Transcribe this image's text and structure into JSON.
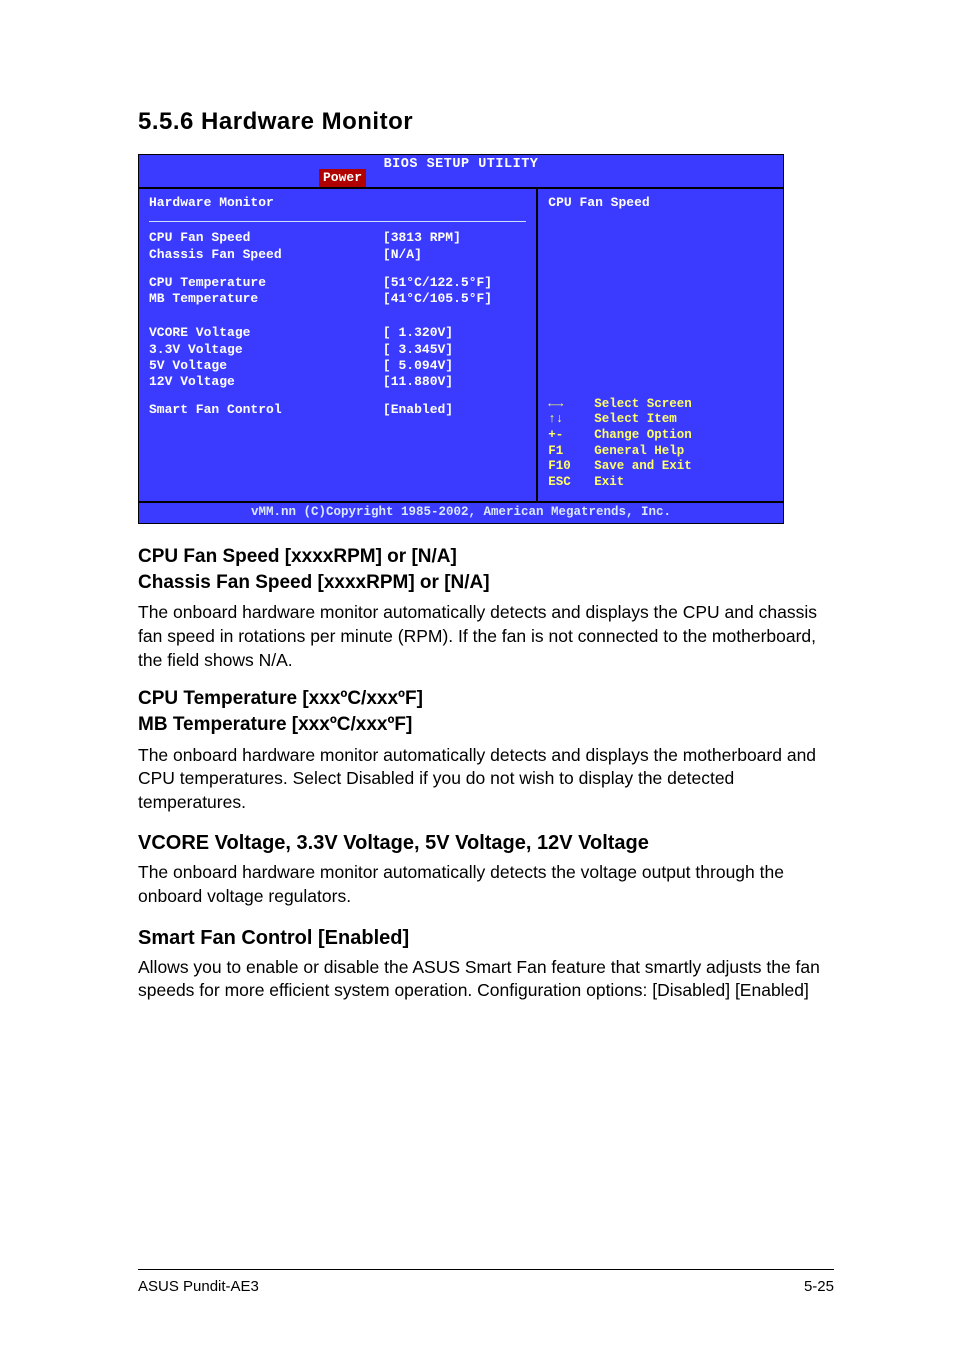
{
  "heading": "5.5.6   Hardware Monitor",
  "bios": {
    "title": "BIOS SETUP UTILITY",
    "tab": "Power",
    "panelTitle": "Hardware Monitor",
    "helpTitle": "CPU Fan Speed",
    "rows1": [
      {
        "label": "CPU Fan Speed",
        "value": "[3813 RPM]"
      },
      {
        "label": "Chassis Fan Speed",
        "value": "[N/A]"
      }
    ],
    "rows2": [
      {
        "label": "CPU Temperature",
        "value": "[51°C/122.5°F]"
      },
      {
        "label": "MB Temperature",
        "value": "[41°C/105.5°F]"
      }
    ],
    "rows3": [
      {
        "label": "VCORE Voltage",
        "value": "[ 1.320V]"
      },
      {
        "label": "3.3V Voltage",
        "value": "[ 3.345V]"
      },
      {
        "label": "5V Voltage",
        "value": "[ 5.094V]"
      },
      {
        "label": "12V Voltage",
        "value": "[11.880V]"
      }
    ],
    "rows4": [
      {
        "label": "Smart Fan Control",
        "value": "[Enabled]"
      }
    ],
    "nav": [
      {
        "key": "←→",
        "act": "Select Screen"
      },
      {
        "key": "↑↓",
        "act": "Select Item"
      },
      {
        "key": "+-",
        "act": "Change Option"
      },
      {
        "key": "F1",
        "act": "General Help"
      },
      {
        "key": "F10",
        "act": "Save and Exit"
      },
      {
        "key": "ESC",
        "act": "Exit"
      }
    ],
    "footer": "vMM.nn (C)Copyright 1985-2002, American Megatrends, Inc."
  },
  "sections": {
    "fan": {
      "h1": "CPU Fan Speed [xxxxRPM] or [N/A]",
      "h2": "Chassis Fan Speed [xxxxRPM] or [N/A]",
      "p": "The onboard hardware monitor automatically detects and displays the CPU and chassis fan speed in rotations per minute (RPM). If the fan is not connected to the motherboard, the field shows N/A."
    },
    "temp": {
      "h1": "CPU Temperature [xxxºC/xxxºF]",
      "h2": "MB Temperature [xxxºC/xxxºF]",
      "p": "The onboard hardware monitor automatically detects and displays the motherboard and CPU temperatures. Select Disabled if you do not wish to display the detected temperatures."
    },
    "volt": {
      "h": "VCORE Voltage, 3.3V Voltage, 5V Voltage, 12V Voltage",
      "p": "The onboard hardware monitor automatically detects the voltage output through the onboard voltage regulators."
    },
    "smart": {
      "h": "Smart Fan Control [Enabled]",
      "p": "Allows you to enable or disable the ASUS Smart Fan feature that smartly adjusts the fan speeds for more efficient system operation. Configuration options: [Disabled] [Enabled]"
    }
  },
  "pageFooter": {
    "left": "ASUS Pundit-AE3",
    "right": "5-25"
  }
}
